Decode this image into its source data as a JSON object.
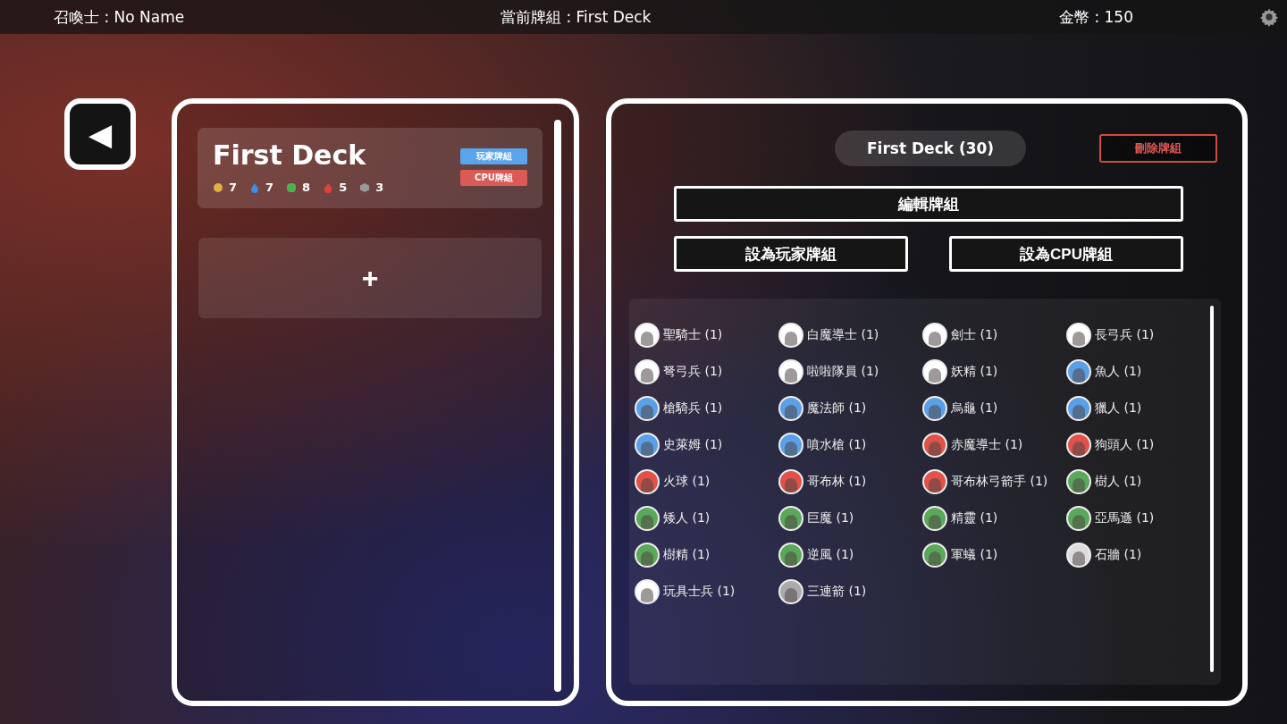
{
  "top_bar": {
    "summoner": "召喚士 : No Name",
    "current_deck": "當前牌組 : First Deck",
    "coins": "金幣 : 150"
  },
  "back_button": {
    "label": "◀"
  },
  "deck_list": [
    {
      "name": "First Deck",
      "selected": true,
      "tags": [
        {
          "label": "玩家牌組",
          "color": "#5aa4ec"
        },
        {
          "label": "CPU牌組",
          "color": "#dc5a55"
        }
      ],
      "stats": [
        {
          "kind": "light",
          "count": "7"
        },
        {
          "kind": "water",
          "count": "7"
        },
        {
          "kind": "leaf",
          "count": "8"
        },
        {
          "kind": "fire",
          "count": "5"
        },
        {
          "kind": "neutral",
          "count": "3"
        }
      ]
    }
  ],
  "add_deck": {
    "label": "+"
  },
  "detail": {
    "title": "First Deck (30)",
    "delete_button": "刪除牌組",
    "edit_button": "編輯牌組",
    "set_player_button": "設為玩家牌組",
    "set_cpu_button": "設為CPU牌組",
    "cards": [
      {
        "name": "聖騎士 (1)",
        "color": "#ffffff"
      },
      {
        "name": "白魔導士 (1)",
        "color": "#ffffff"
      },
      {
        "name": "劍士 (1)",
        "color": "#ffffff"
      },
      {
        "name": "長弓兵 (1)",
        "color": "#ffffff"
      },
      {
        "name": "弩弓兵 (1)",
        "color": "#ffffff"
      },
      {
        "name": "啦啦隊員 (1)",
        "color": "#ffffff"
      },
      {
        "name": "妖精 (1)",
        "color": "#ffffff"
      },
      {
        "name": "魚人 (1)",
        "color": "#5a9fe8"
      },
      {
        "name": "槍騎兵 (1)",
        "color": "#5a9fe8"
      },
      {
        "name": "魔法師 (1)",
        "color": "#5a9fe8"
      },
      {
        "name": "烏龜 (1)",
        "color": "#5a9fe8"
      },
      {
        "name": "獵人 (1)",
        "color": "#5a9fe8"
      },
      {
        "name": "史萊姆 (1)",
        "color": "#5a9fe8"
      },
      {
        "name": "噴水槍 (1)",
        "color": "#5a9fe8"
      },
      {
        "name": "赤魔導士 (1)",
        "color": "#e0524a"
      },
      {
        "name": "狗頭人 (1)",
        "color": "#e0524a"
      },
      {
        "name": "火球 (1)",
        "color": "#e0524a"
      },
      {
        "name": "哥布林 (1)",
        "color": "#e0524a"
      },
      {
        "name": "哥布林弓箭手 (1)",
        "color": "#e0524a"
      },
      {
        "name": "樹人 (1)",
        "color": "#5aa85a"
      },
      {
        "name": "矮人 (1)",
        "color": "#5aa85a"
      },
      {
        "name": "巨魔 (1)",
        "color": "#5aa85a"
      },
      {
        "name": "精靈 (1)",
        "color": "#5aa85a"
      },
      {
        "name": "亞馬遜 (1)",
        "color": "#5aa85a"
      },
      {
        "name": "樹精 (1)",
        "color": "#5aa85a"
      },
      {
        "name": "逆風 (1)",
        "color": "#5aa85a"
      },
      {
        "name": "軍蟻 (1)",
        "color": "#5aa85a"
      },
      {
        "name": "石牆 (1)",
        "color": "#dddddd"
      },
      {
        "name": "玩具士兵 (1)",
        "color": "#ffffff"
      },
      {
        "name": "三連箭 (1)",
        "color": "#aaaaaa"
      }
    ]
  }
}
